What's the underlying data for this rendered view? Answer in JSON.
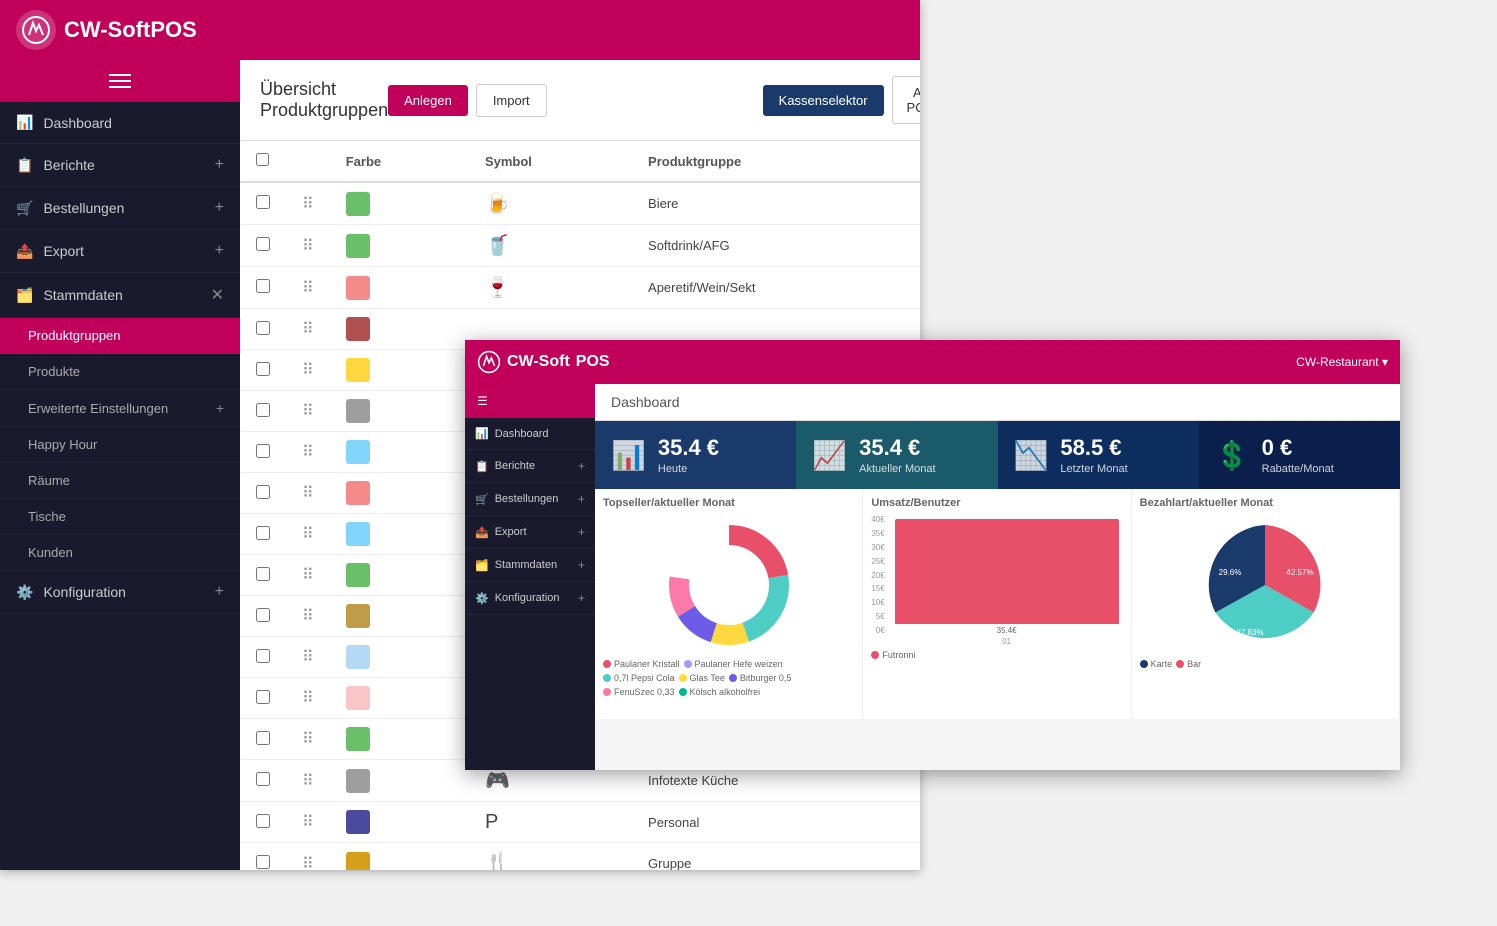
{
  "app": {
    "name_light": "CW-Soft",
    "name_bold": "POS"
  },
  "main_window": {
    "title": "Übersicht Produktgruppen",
    "buttons": {
      "anlegen": "Anlegen",
      "import": "Import",
      "kassenselektor": "Kassenselektor",
      "all_pos": "All POS"
    },
    "table": {
      "columns": [
        "Farbe",
        "Symbol",
        "Produktgruppe"
      ],
      "rows": [
        {
          "color": "#6abf69",
          "icon": "🍺",
          "name": "Biere"
        },
        {
          "color": "#6abf69",
          "icon": "🥤",
          "name": "Softdrink/AFG"
        },
        {
          "color": "#f48b8b",
          "icon": "🍷",
          "name": "Aperetif/Wein/Sekt"
        },
        {
          "color": "#b05050",
          "icon": "",
          "name": ""
        },
        {
          "color": "#ffd740",
          "icon": "",
          "name": ""
        },
        {
          "color": "#9e9e9e",
          "icon": "",
          "name": ""
        },
        {
          "color": "#81d4fa",
          "icon": "",
          "name": ""
        },
        {
          "color": "#f48b8b",
          "icon": "",
          "name": ""
        },
        {
          "color": "#81d4fa",
          "icon": "",
          "name": ""
        },
        {
          "color": "#6abf69",
          "icon": "",
          "name": ""
        },
        {
          "color": "#bf9b4a",
          "icon": "",
          "name": ""
        },
        {
          "color": "#b3d9f5",
          "icon": "",
          "name": ""
        },
        {
          "color": "#f9c5c5",
          "icon": "",
          "name": ""
        },
        {
          "color": "#6abf69",
          "icon": "",
          "name": ""
        },
        {
          "color": "#9e9e9e",
          "icon": "🎮",
          "name": "Infotexte Küche"
        },
        {
          "color": "#4a4a9e",
          "icon": "P",
          "name": "Personal"
        },
        {
          "color": "#d4a017",
          "icon": "🍴",
          "name": "Gruppe"
        }
      ]
    }
  },
  "sidebar": {
    "menu_icon": "☰",
    "items": [
      {
        "label": "Dashboard",
        "icon": "📊",
        "has_plus": false
      },
      {
        "label": "Berichte",
        "icon": "📋",
        "has_plus": true
      },
      {
        "label": "Bestellungen",
        "icon": "🛒",
        "has_plus": true
      },
      {
        "label": "Export",
        "icon": "📤",
        "has_plus": true
      },
      {
        "label": "Stammdaten",
        "icon": "🗂️",
        "has_plus": false,
        "expanded": true
      },
      {
        "label": "Konfiguration",
        "icon": "⚙️",
        "has_plus": true
      }
    ],
    "sub_items": [
      {
        "label": "Produktgruppen",
        "active": true
      },
      {
        "label": "Produkte"
      },
      {
        "label": "Erweiterte Einstellungen"
      },
      {
        "label": "Happy Hour"
      },
      {
        "label": "Räume"
      },
      {
        "label": "Tische"
      },
      {
        "label": "Kunden"
      }
    ]
  },
  "overlay": {
    "title_light": "CW-Soft",
    "title_bold": "POS",
    "user_label": "CW-Restaurant ▾",
    "dashboard_label": "Dashboard",
    "sidebar_items": [
      {
        "label": "Dashboard",
        "icon": "📊"
      },
      {
        "label": "Berichte",
        "icon": "📋"
      },
      {
        "label": "Bestellungen",
        "icon": "🛒"
      },
      {
        "label": "Export",
        "icon": "📤"
      },
      {
        "label": "Stammdaten",
        "icon": "🗂️"
      },
      {
        "label": "Konfiguration",
        "icon": "⚙️"
      }
    ],
    "stats": [
      {
        "value": "35.4 €",
        "label": "Heute",
        "icon": "📊"
      },
      {
        "value": "35.4 €",
        "label": "Aktueller Monat",
        "icon": "📈"
      },
      {
        "value": "58.5 €",
        "label": "Letzter Monat",
        "icon": "📉"
      },
      {
        "value": "0 €",
        "label": "Rabatte/Monat",
        "icon": "💲"
      }
    ],
    "charts": {
      "topseller": {
        "title": "Topseller/aktueller Monat",
        "segments": [
          {
            "color": "#e8506a",
            "pct": 22.22,
            "label": "22.22%"
          },
          {
            "color": "#4ecdc4",
            "pct": 22.25,
            "label": "22.25%"
          },
          {
            "color": "#ffd93d",
            "pct": 10.35,
            "label": "10.35%"
          },
          {
            "color": "#a29bfe",
            "pct": 11.11,
            "label": "11.11%"
          },
          {
            "color": "#fd79a8",
            "pct": 11.11,
            "label": "11.11%"
          },
          {
            "color": "#6c5ce7",
            "pct": 11.11,
            "label": "11.11%"
          },
          {
            "color": "#00b894",
            "pct": 11.85,
            "label": "11.85%"
          }
        ],
        "legend": [
          {
            "color": "#e8506a",
            "label": "Paulaner Kristall"
          },
          {
            "color": "#a29bfe",
            "label": "Paulaner Hefe weizen"
          },
          {
            "color": "#4ecdc4",
            "label": "0,7l Pepsi Cola"
          },
          {
            "color": "#ffd93d",
            "label": "Glas Tee"
          },
          {
            "color": "#6c5ce7",
            "label": "Bitburger 0,5"
          },
          {
            "color": "#fd79a8",
            "label": "FenuSzec 0,33"
          },
          {
            "color": "#00b894",
            "label": "Kölsch alkoholfrei"
          }
        ]
      },
      "umsatz": {
        "title": "Umsatz/Benutzer",
        "y_labels": [
          "40€",
          "35€",
          "30€",
          "25€",
          "20€",
          "15€",
          "10€",
          "5€",
          "0€"
        ],
        "bar_value": 35.4,
        "bar_label": "35.4€",
        "legend_color": "#e8506a",
        "legend_label": "Futronni",
        "x_label": "01"
      },
      "bezahlart": {
        "title": "Bezahlart/aktueller Monat",
        "segments": [
          {
            "color": "#e8506a",
            "pct": 42.57,
            "label": "42.57%"
          },
          {
            "color": "#4ecdc4",
            "pct": 27.83,
            "label": "27.83%"
          },
          {
            "color": "#1a3a6b",
            "pct": 29.6,
            "label": "29.6%"
          }
        ],
        "legend": [
          {
            "color": "#1a3a6b",
            "label": "Karte"
          },
          {
            "color": "#e8506a",
            "label": "Bar"
          }
        ]
      }
    }
  }
}
